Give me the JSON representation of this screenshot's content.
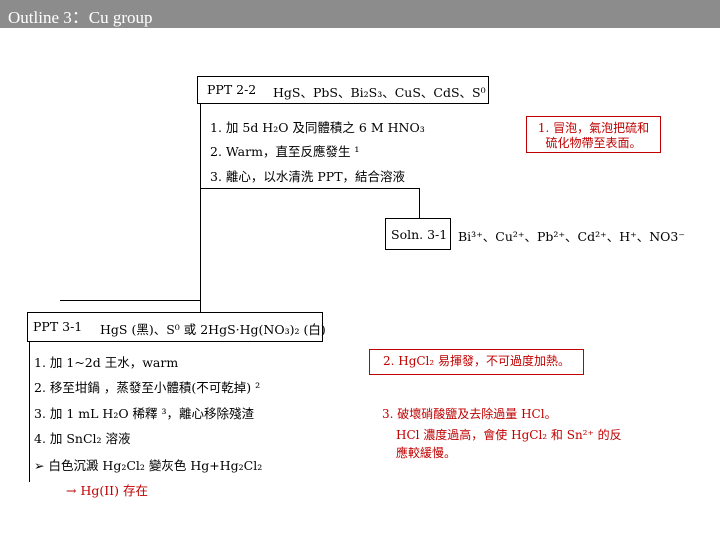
{
  "title": "Outline 3：Cu group",
  "ppt22": {
    "label": "PPT 2-2",
    "compounds": "HgS、PbS、Bi₂S₃、CuS、CdS、S⁰"
  },
  "steps_a": [
    "1. 加 5d H₂O 及同體積之 6 M HNO₃",
    "2. Warm，直至反應發生 ¹",
    "3. 離心，以水清洗 PPT，結合溶液"
  ],
  "note_a": [
    "1. 冒泡，氣泡把硫和",
    "硫化物帶至表面。"
  ],
  "soln31": {
    "label": "Soln. 3-1",
    "ions": "Bi³⁺、Cu²⁺、Pb²⁺、Cd²⁺、H⁺、NO3⁻"
  },
  "ppt31": {
    "label": "PPT 3-1",
    "compounds": "HgS (黑)、S⁰ 或 2HgS·Hg(NO₃)₂ (白)"
  },
  "steps_b": [
    "1.  加 1~2d 王水，warm",
    "2.  移至坩鍋 ，蒸發至小體積(不可乾掉) ²",
    "3.  加 1 mL H₂O 稀釋 ³，離心移除殘渣",
    "4.  加 SnCl₂ 溶液",
    "➢  白色沉澱 Hg₂Cl₂ 變灰色 Hg+Hg₂Cl₂",
    "→ Hg(II) 存在"
  ],
  "note_b1": "2. HgCl₂ 易揮發，不可過度加熱。",
  "note_b2": [
    "3. 破壞硝酸鹽及去除過量 HCl。",
    "HCl 濃度過高，會使 HgCl₂ 和 Sn²⁺ 的反",
    "應較緩慢。"
  ],
  "colors": {
    "title_bar": "#8c8c8c",
    "accent": "#c00000"
  }
}
